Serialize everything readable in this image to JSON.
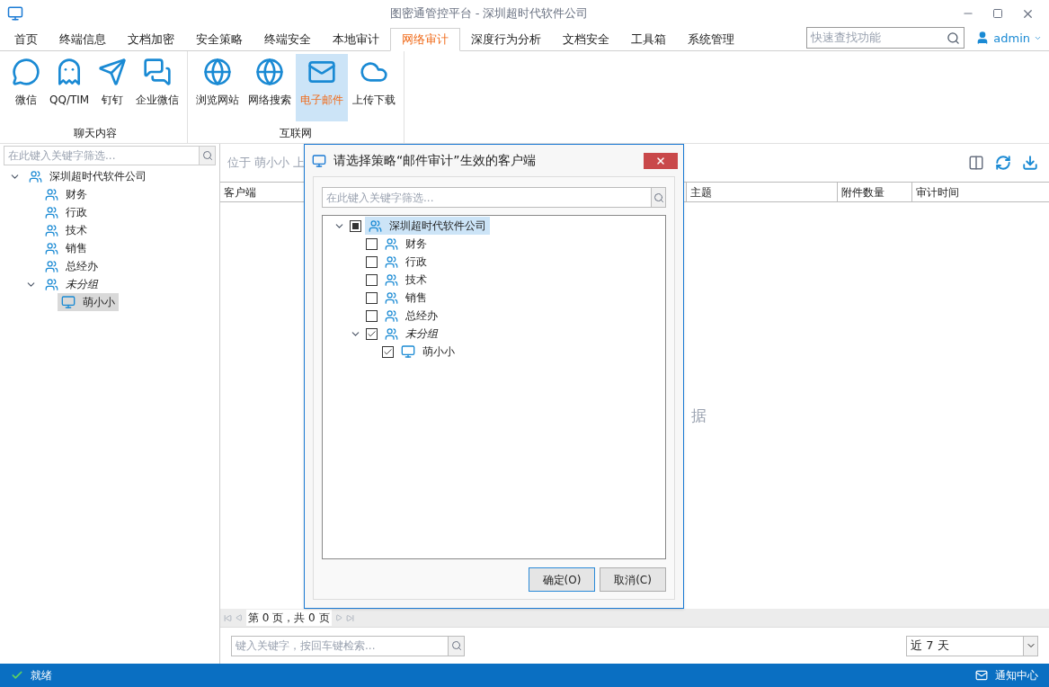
{
  "window": {
    "title": "图密通管控平台 - 深圳超时代软件公司"
  },
  "tabs": [
    {
      "label": "首页",
      "selected": false
    },
    {
      "label": "终端信息",
      "selected": false
    },
    {
      "label": "文档加密",
      "selected": false
    },
    {
      "label": "安全策略",
      "selected": false
    },
    {
      "label": "终端安全",
      "selected": false
    },
    {
      "label": "本地审计",
      "selected": false
    },
    {
      "label": "网络审计",
      "selected": true
    },
    {
      "label": "深度行为分析",
      "selected": false
    },
    {
      "label": "文档安全",
      "selected": false
    },
    {
      "label": "工具箱",
      "selected": false
    },
    {
      "label": "系统管理",
      "selected": false
    }
  ],
  "quick_search": {
    "placeholder": "快速查找功能"
  },
  "user": {
    "name": "admin"
  },
  "ribbon_groups": [
    {
      "label": "聊天内容",
      "items": [
        {
          "label": "微信",
          "selected": false
        },
        {
          "label": "QQ/TIM",
          "selected": false
        },
        {
          "label": "钉钉",
          "selected": false
        },
        {
          "label": "企业微信",
          "selected": false
        }
      ]
    },
    {
      "label": "互联网",
      "items": [
        {
          "label": "浏览网站",
          "selected": false
        },
        {
          "label": "网络搜索",
          "selected": false
        },
        {
          "label": "电子邮件",
          "selected": true
        },
        {
          "label": "上传下载",
          "selected": false
        }
      ]
    }
  ],
  "sidebar": {
    "search": {
      "placeholder": "在此键入关键字筛选..."
    },
    "tree": [
      {
        "label": "深圳超时代软件公司",
        "kind": "group",
        "expanded": true,
        "selected": false,
        "children": [
          {
            "label": "财务",
            "kind": "group",
            "selected": false
          },
          {
            "label": "行政",
            "kind": "group",
            "selected": false
          },
          {
            "label": "技术",
            "kind": "group",
            "selected": false
          },
          {
            "label": "销售",
            "kind": "group",
            "selected": false
          },
          {
            "label": "总经办",
            "kind": "group",
            "selected": false
          },
          {
            "label": "未分组",
            "kind": "ungrouped",
            "expanded": true,
            "selected": false,
            "children": [
              {
                "label": "萌小小",
                "kind": "computer",
                "selected": true
              }
            ]
          }
        ]
      }
    ]
  },
  "main": {
    "location": "位于 萌小小 上",
    "columns": [
      "客户端",
      "主题",
      "附件数量",
      "审计时间"
    ],
    "empty_message": "据",
    "pager": "第 0 页，共 0 页",
    "search": {
      "placeholder": "键入关键字，按回车键检索..."
    },
    "range": {
      "value": "近 7 天"
    }
  },
  "dialog": {
    "title": "请选择策略“邮件审计”生效的客户端",
    "search": {
      "placeholder": "在此键入关键字筛选..."
    },
    "tree": [
      {
        "label": "深圳超时代软件公司",
        "kind": "group",
        "expanded": true,
        "checked": false,
        "partial": true,
        "selected": true,
        "children": [
          {
            "label": "财务",
            "kind": "group",
            "checked": false,
            "partial": false,
            "selected": false
          },
          {
            "label": "行政",
            "kind": "group",
            "checked": false,
            "partial": false,
            "selected": false
          },
          {
            "label": "技术",
            "kind": "group",
            "checked": false,
            "partial": false,
            "selected": false
          },
          {
            "label": "销售",
            "kind": "group",
            "checked": false,
            "partial": false,
            "selected": false
          },
          {
            "label": "总经办",
            "kind": "group",
            "checked": false,
            "partial": false,
            "selected": false
          },
          {
            "label": "未分组",
            "kind": "ungrouped",
            "expanded": true,
            "checked": true,
            "partial": false,
            "selected": false,
            "children": [
              {
                "label": "萌小小",
                "kind": "computer",
                "checked": true,
                "partial": false,
                "selected": false
              }
            ]
          }
        ]
      }
    ],
    "buttons": [
      {
        "label": "确定(O)",
        "default": true
      },
      {
        "label": "取消(C)",
        "default": false
      }
    ]
  },
  "status_bar": {
    "status": "就绪",
    "notifications": "通知中心"
  }
}
